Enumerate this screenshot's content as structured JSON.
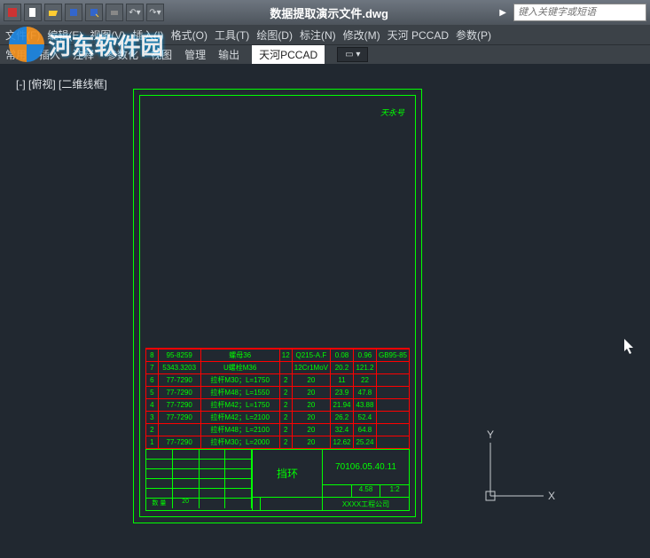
{
  "title": "数据提取演示文件.dwg",
  "search_placeholder": "键入关键字或短语",
  "menu": [
    "文件(F)",
    "编辑(E)",
    "视图(V)",
    "插入(I)",
    "格式(O)",
    "工具(T)",
    "绘图(D)",
    "标注(N)",
    "修改(M)",
    "天河 PCCAD",
    "参数(P)"
  ],
  "ribbon": [
    "常用",
    "插入",
    "注释",
    "参数化",
    "视图",
    "管理",
    "输出",
    "天河PCCAD"
  ],
  "view_label": "[-] [俯视] [二维线框]",
  "corner_mark": "天永号",
  "ucs": {
    "x": "X",
    "y": "Y"
  },
  "bom": [
    {
      "n": "8",
      "code": "95-8259",
      "desc": "螺母36",
      "q": "12",
      "mat": "Q215-A.F",
      "w1": "0.08",
      "w2": "0.96",
      "rem": "GB95-85"
    },
    {
      "n": "7",
      "code": "5343.3203",
      "desc": "U螺栓M36",
      "q": "",
      "mat": "12Cr1MoV",
      "w1": "20.2",
      "w2": "121.2",
      "rem": ""
    },
    {
      "n": "6",
      "code": "77-7290",
      "desc": "拉杆M30；L=1750",
      "q": "2",
      "mat": "20",
      "w1": "11",
      "w2": "22",
      "rem": ""
    },
    {
      "n": "5",
      "code": "77-7290",
      "desc": "拉杆M48；L=1550",
      "q": "2",
      "mat": "20",
      "w1": "23.9",
      "w2": "47.8",
      "rem": ""
    },
    {
      "n": "4",
      "code": "77-7290",
      "desc": "拉杆M42；L=1750",
      "q": "2",
      "mat": "20",
      "w1": "21.94",
      "w2": "43.88",
      "rem": ""
    },
    {
      "n": "3",
      "code": "77-7290",
      "desc": "拉杆M42；L=2100",
      "q": "2",
      "mat": "20",
      "w1": "26.2",
      "w2": "52.4",
      "rem": ""
    },
    {
      "n": "2",
      "code": "",
      "desc": "拉杆M48；L=2100",
      "q": "2",
      "mat": "20",
      "w1": "32.4",
      "w2": "64.8",
      "rem": ""
    },
    {
      "n": "1",
      "code": "77-7290",
      "desc": "拉杆M30；L=2000",
      "q": "2",
      "mat": "20",
      "w1": "12.62",
      "w2": "25.24",
      "rem": ""
    }
  ],
  "titleblock": {
    "name": "挡环",
    "partno": "70106.05.40.11",
    "scale": "4.58",
    "sheet": "1:2",
    "qty_label": "数 量",
    "qty": "20",
    "company": "XXXX工程公司"
  }
}
